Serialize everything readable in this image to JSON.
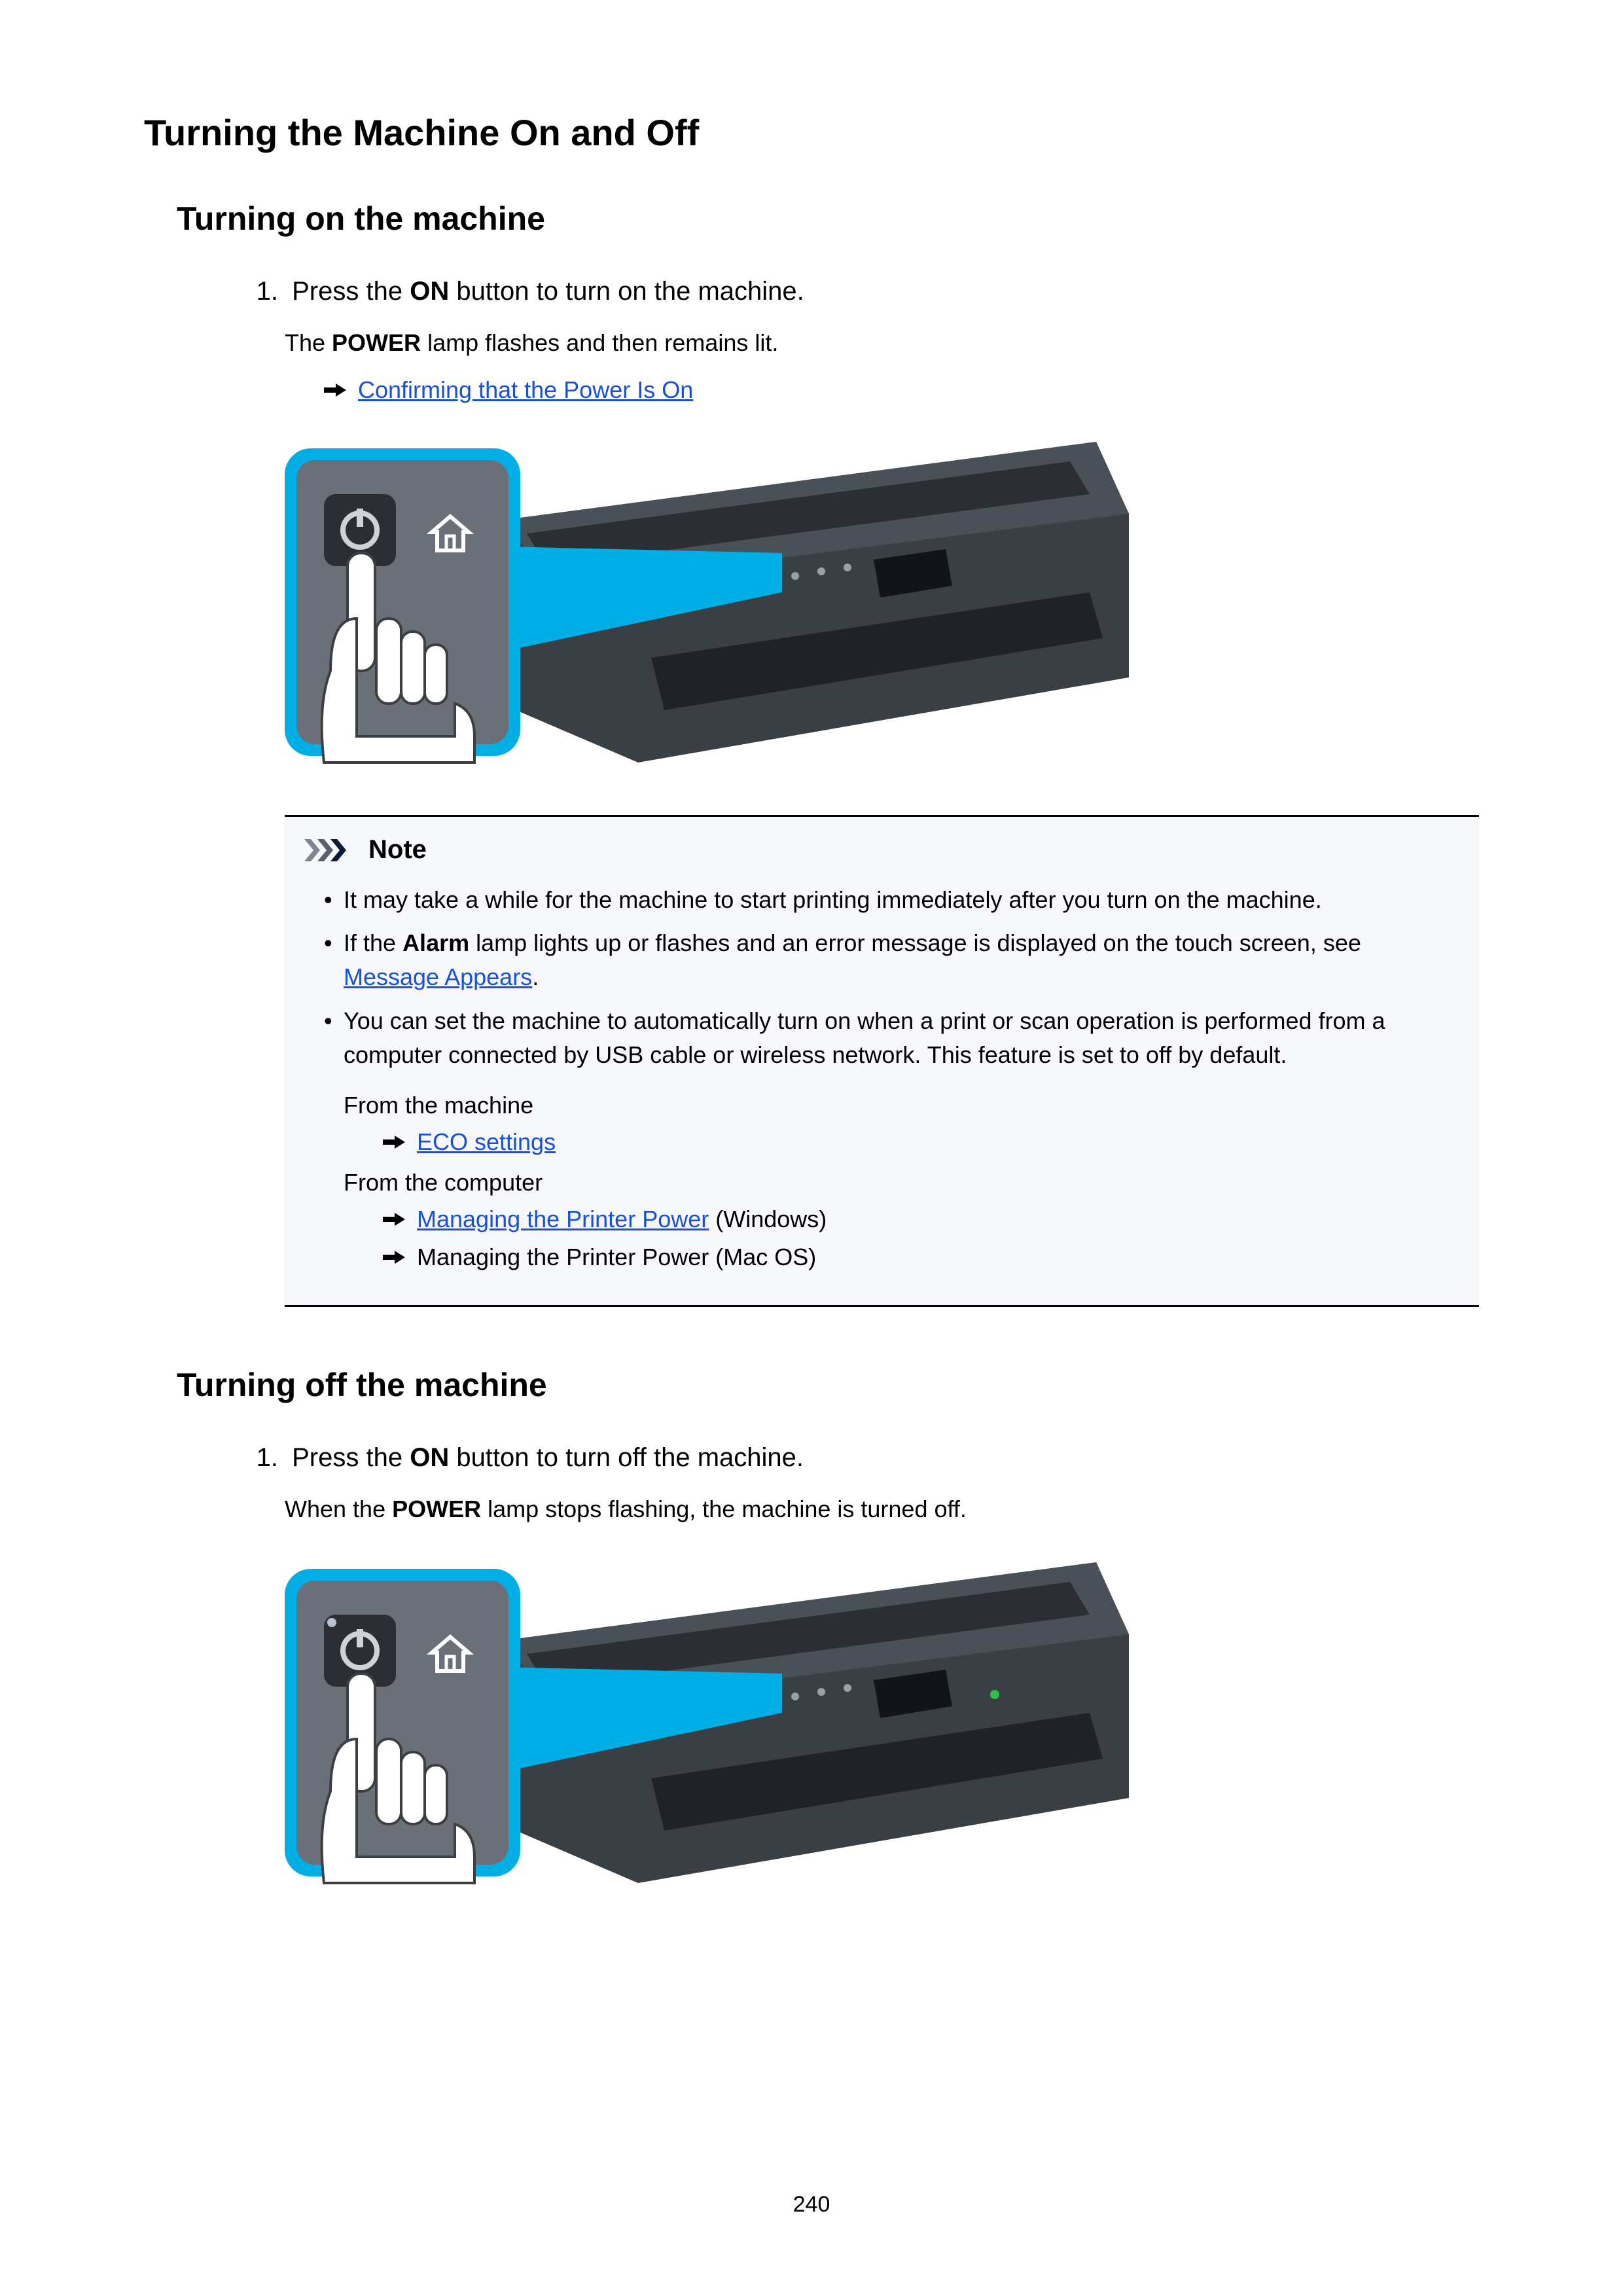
{
  "title": "Turning the Machine On and Off",
  "sectionA": {
    "heading": "Turning on the machine",
    "step_num": "1.",
    "step_prefix": "Press the ",
    "step_bold": "ON",
    "step_suffix": " button to turn on the machine.",
    "sub_prefix": "The ",
    "sub_bold": "POWER",
    "sub_suffix": " lamp flashes and then remains lit.",
    "link_confirm": "Confirming that the Power Is On"
  },
  "note": {
    "label": "Note",
    "bullet1": "It may take a while for the machine to start printing immediately after you turn on the machine.",
    "bullet2_prefix": "If the ",
    "bullet2_bold": "Alarm",
    "bullet2_mid": " lamp lights up or flashes and an error message is displayed on the touch screen, see ",
    "bullet2_link": "Message Appears",
    "bullet2_suffix": ".",
    "bullet3": "You can set the machine to automatically turn on when a print or scan operation is performed from a computer connected by USB cable or wireless network. This feature is set to off by default.",
    "from_machine": "From the machine",
    "eco_link": "ECO settings",
    "from_computer": "From the computer",
    "mpp_link": "Managing the Printer Power",
    "mpp_win": " (Windows)",
    "mpp_text": "Managing the Printer Power",
    "mpp_mac": " (Mac OS)"
  },
  "sectionB": {
    "heading": "Turning off the machine",
    "step_num": "1.",
    "step_prefix": "Press the ",
    "step_bold": "ON",
    "step_suffix": " button to turn off the machine.",
    "sub_prefix": "When the ",
    "sub_bold": "POWER",
    "sub_suffix": " lamp stops flashing, the machine is turned off."
  },
  "page_number": "240",
  "colors": {
    "link": "#1a4fd8",
    "note_bg": "#f6f8fc",
    "callout": "#00aee6",
    "printer_dark": "#3a3f44",
    "printer_darker": "#2b2f33",
    "panel_bg": "#6a6f78"
  }
}
